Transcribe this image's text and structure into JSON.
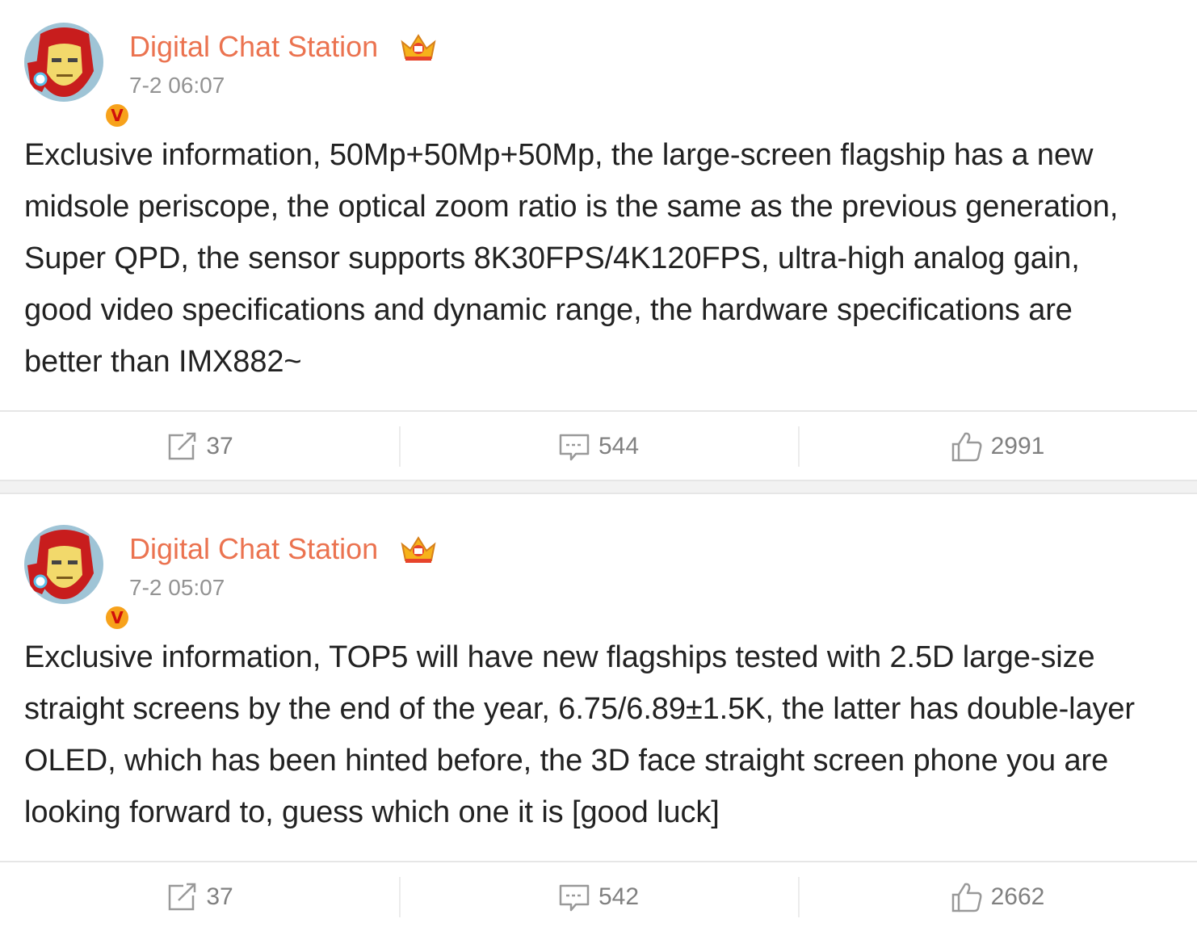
{
  "posts": [
    {
      "author": "Digital Chat Station",
      "time": "7-2 06:07",
      "verified": "V",
      "text": "Exclusive information, 50Mp+50Mp+50Mp, the large-screen flagship has a new midsole periscope, the optical zoom ratio is the same as the previous generation, Super QPD, the sensor supports 8K30FPS/4K120FPS, ultra-high analog gain, good video specifications and dynamic range, the hardware specifications are better than IMX882~",
      "reposts": "37",
      "comments": "544",
      "likes": "2991"
    },
    {
      "author": "Digital Chat Station",
      "time": "7-2 05:07",
      "verified": "V",
      "text": "Exclusive information, TOP5 will have new flagships tested with 2.5D large-size straight screens by the end of the year, 6.75/6.89±1.5K, the latter has double-layer OLED, which has been hinted before, the 3D face straight screen phone you are looking forward to, guess which one it is [good luck]",
      "reposts": "37",
      "comments": "542",
      "likes": "2662"
    }
  ],
  "icons": {
    "avatar": "iron-man-avatar",
    "badge": "crown-icon",
    "repost": "repost-icon",
    "comment": "comment-icon",
    "like": "thumbs-up-icon"
  },
  "colors": {
    "author": "#eb7350",
    "time": "#939393",
    "text": "#222222",
    "action": "#808080",
    "badge": "#f7a21b"
  }
}
